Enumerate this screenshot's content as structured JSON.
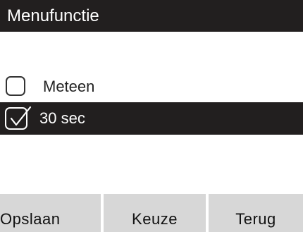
{
  "header": {
    "title": "Menufunctie"
  },
  "options": [
    {
      "label": "Meteen",
      "checked": false
    },
    {
      "label": "30 sec",
      "checked": true
    }
  ],
  "softkeys": {
    "left": "Opslaan",
    "middle": "Keuze",
    "right": "Terug"
  },
  "colors": {
    "dark": "#221f1f",
    "softkey_bg": "#d7d7d7"
  }
}
